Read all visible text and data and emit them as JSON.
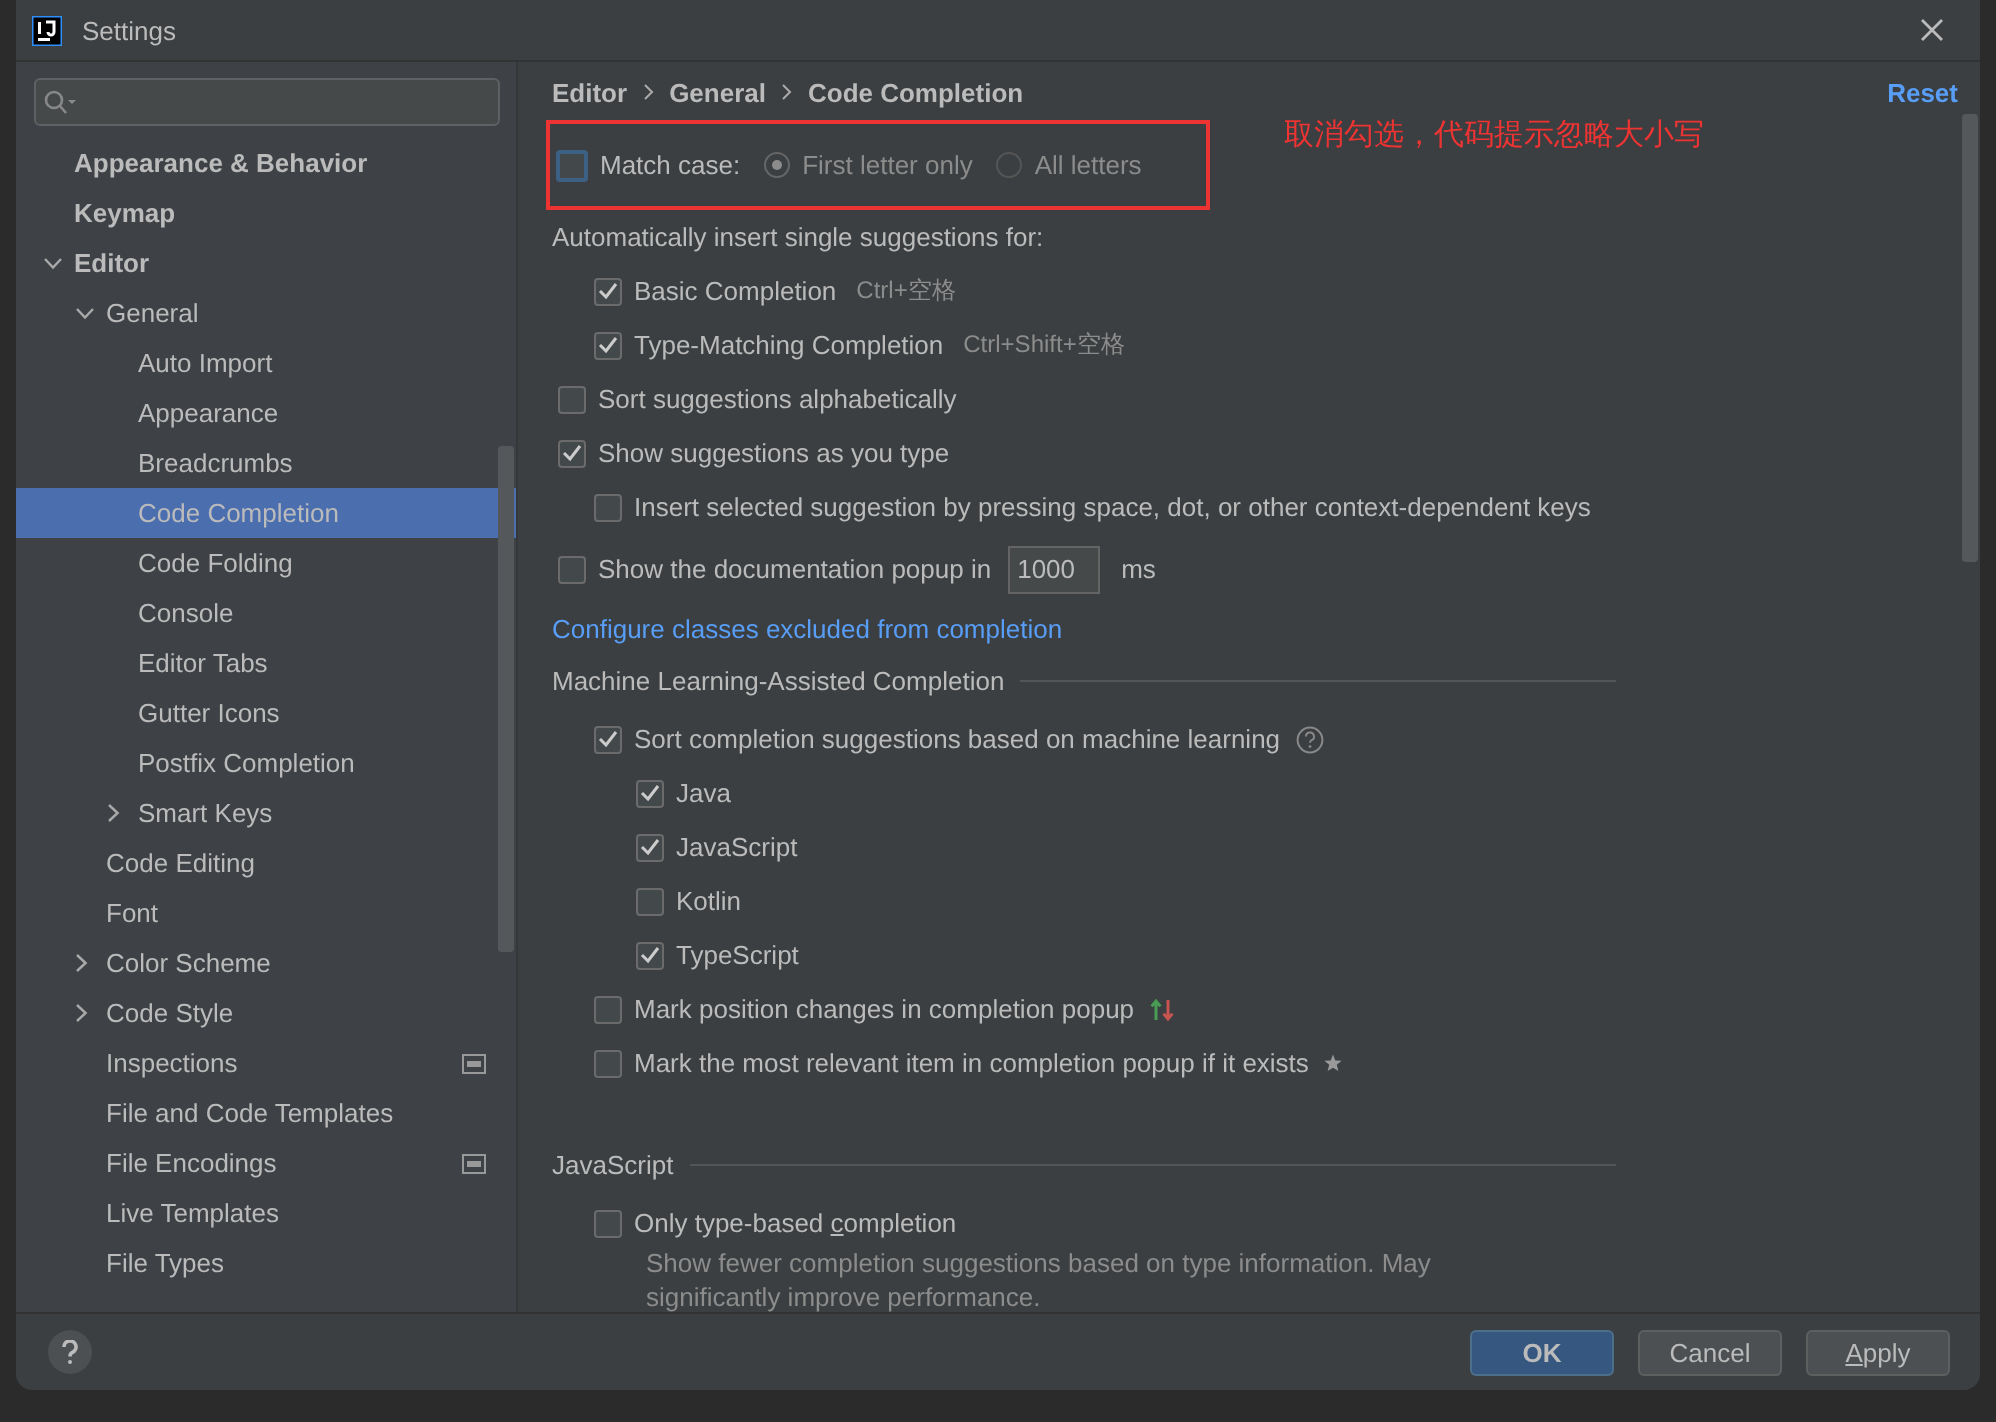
{
  "window": {
    "title": "Settings"
  },
  "sidebar": {
    "items": [
      {
        "label": "Appearance & Behavior",
        "selected": false
      },
      {
        "label": "Keymap",
        "selected": false
      },
      {
        "label": "Editor",
        "selected": false,
        "expanded": true,
        "children": [
          {
            "label": "General",
            "selected": false,
            "expanded": true,
            "children": [
              {
                "label": "Auto Import",
                "selected": false
              },
              {
                "label": "Appearance",
                "selected": false
              },
              {
                "label": "Breadcrumbs",
                "selected": false
              },
              {
                "label": "Code Completion",
                "selected": true
              },
              {
                "label": "Code Folding",
                "selected": false
              },
              {
                "label": "Console",
                "selected": false
              },
              {
                "label": "Editor Tabs",
                "selected": false
              },
              {
                "label": "Gutter Icons",
                "selected": false
              },
              {
                "label": "Postfix Completion",
                "selected": false
              },
              {
                "label": "Smart Keys",
                "selected": false,
                "expanded": false
              }
            ]
          },
          {
            "label": "Code Editing",
            "selected": false
          },
          {
            "label": "Font",
            "selected": false
          },
          {
            "label": "Color Scheme",
            "selected": false,
            "expanded": false
          },
          {
            "label": "Code Style",
            "selected": false,
            "expanded": false
          },
          {
            "label": "Inspections",
            "selected": false,
            "project_icon": true
          },
          {
            "label": "File and Code Templates",
            "selected": false
          },
          {
            "label": "File Encodings",
            "selected": false,
            "project_icon": true
          },
          {
            "label": "Live Templates",
            "selected": false
          },
          {
            "label": "File Types",
            "selected": false
          }
        ]
      }
    ]
  },
  "content": {
    "breadcrumbs": [
      "Editor",
      "General",
      "Code Completion"
    ],
    "reset": "Reset",
    "annotation": {
      "text": "取消勾选，代码提示忽略大小写"
    },
    "match_case": {
      "label": "Match case:",
      "checked": false,
      "options": [
        {
          "label": "First letter only",
          "selected": true,
          "disabled": true
        },
        {
          "label": "All letters",
          "selected": false,
          "disabled": true
        }
      ]
    },
    "items": [
      {
        "kind": "label",
        "label": "Automatically insert single suggestions for:",
        "children": [
          {
            "kind": "checkbox",
            "label": "Basic Completion",
            "checked": true,
            "shortcut": "Ctrl+空格"
          },
          {
            "kind": "checkbox",
            "label": "Type-Matching Completion",
            "checked": true,
            "shortcut": "Ctrl+Shift+空格"
          }
        ]
      },
      {
        "kind": "checkbox",
        "label": "Sort suggestions alphabetically",
        "checked": false
      },
      {
        "kind": "checkbox",
        "label": "Show suggestions as you type",
        "checked": true,
        "children": [
          {
            "kind": "checkbox",
            "label": "Insert selected suggestion by pressing space, dot, or other context-dependent keys",
            "checked": false
          }
        ]
      },
      {
        "kind": "number",
        "label": "Show the documentation popup in",
        "checked": false,
        "value": "1000",
        "unit": "ms"
      },
      {
        "kind": "link",
        "label": "Configure classes excluded from completion"
      },
      {
        "kind": "section",
        "label": "Machine Learning-Assisted Completion",
        "children": [
          {
            "kind": "checkbox",
            "label": "Sort completion suggestions based on machine learning",
            "checked": true,
            "trailing": {
              "kind": "help"
            },
            "children": [
              {
                "kind": "checkbox",
                "label": "Java",
                "checked": true
              },
              {
                "kind": "checkbox",
                "label": "JavaScript",
                "checked": true
              },
              {
                "kind": "checkbox",
                "label": "Kotlin",
                "checked": false
              },
              {
                "kind": "checkbox",
                "label": "TypeScript",
                "checked": true
              }
            ]
          },
          {
            "kind": "checkbox",
            "label": "Mark position changes in completion popup",
            "checked": false,
            "trailing": {
              "kind": "arrows"
            }
          },
          {
            "kind": "checkbox",
            "label": "Mark the most relevant item in completion popup if it exists",
            "checked": false,
            "trailing": {
              "kind": "star"
            }
          }
        ]
      },
      {
        "kind": "section",
        "label": "JavaScript",
        "children": [
          {
            "kind": "checkbox",
            "label_parts": [
              {
                "text": "Only type-based ",
                "underline": false
              },
              {
                "text": "c",
                "underline": true
              },
              {
                "text": "ompletion",
                "underline": false
              }
            ],
            "checked": false,
            "description": [
              "Show fewer completion suggestions based on type information. May",
              "significantly improve performance."
            ]
          }
        ]
      }
    ]
  },
  "footer": {
    "buttons": [
      {
        "label": "OK",
        "default": true
      },
      {
        "label": "Cancel",
        "default": false
      },
      {
        "label_parts": [
          {
            "text": "A",
            "underline": true
          },
          {
            "text": "pply",
            "underline": false
          }
        ],
        "default": false
      }
    ]
  }
}
